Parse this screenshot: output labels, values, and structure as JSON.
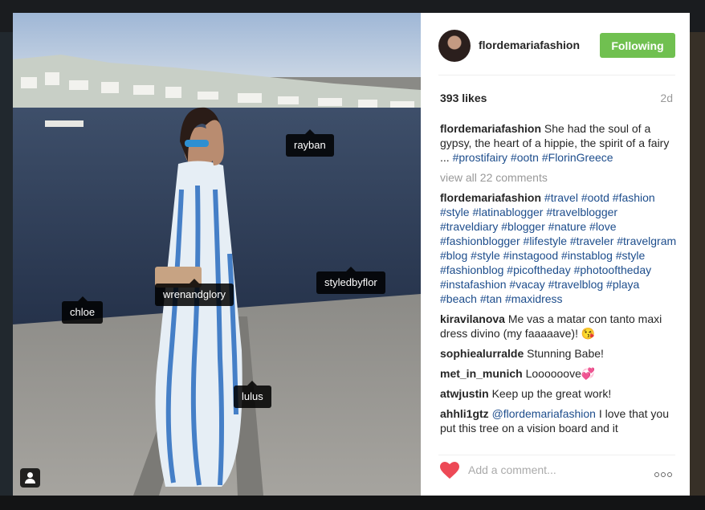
{
  "post": {
    "username": "flordemariafashion",
    "follow_label": "Following",
    "likes": "393 likes",
    "age": "2d",
    "view_all_comments": "view all 22 comments",
    "add_comment_placeholder": "Add a comment...",
    "tags": [
      "rayban",
      "wrenandglory",
      "styledbyflor",
      "chloe",
      "lulus"
    ],
    "caption": {
      "author": "flordemariafashion",
      "text": "She had the soul of a gypsy, the heart of a hippie, the spirit of a fairy ...",
      "hashtags": [
        "#prostifairy",
        "#ootn",
        "#FlorinGreece"
      ]
    },
    "comments": [
      {
        "author": "flordemariafashion",
        "text": "",
        "hashtags": [
          "#travel",
          "#ootd",
          "#fashion",
          "#style",
          "#latinablogger",
          "#travelblogger",
          "#traveldiary",
          "#blogger",
          "#nature",
          "#love",
          "#fashionblogger",
          "#lifestyle",
          "#traveler",
          "#travelgram",
          "#blog",
          "#style",
          "#instagood",
          "#instablog",
          "#style",
          "#fashionblog",
          "#picoftheday",
          "#photooftheday",
          "#instafashion",
          "#vacay",
          "#travelblog",
          "#playa",
          "#beach",
          "#tan",
          "#maxidress"
        ]
      },
      {
        "author": "kiravilanova",
        "text": "Me vas a matar con tanto maxi dress divino (my faaaaave)! 😘"
      },
      {
        "author": "sophiealurralde",
        "text": "Stunning Babe!"
      },
      {
        "author": "met_in_munich",
        "text": "Loooooove💞"
      },
      {
        "author": "atwjustin",
        "text": "Keep up the great work!"
      },
      {
        "author": "ahhli1gtz",
        "mention": "@flordemariafashion",
        "text": "I love that you put this tree on a vision board and it"
      }
    ]
  },
  "colors": {
    "follow_green": "#70c050",
    "hashtag_blue": "#1d4d8c",
    "heart_red": "#ed4956"
  },
  "icons": {
    "like": "heart-icon",
    "more": "more-options-icon",
    "user_tags": "user-tag-icon"
  }
}
